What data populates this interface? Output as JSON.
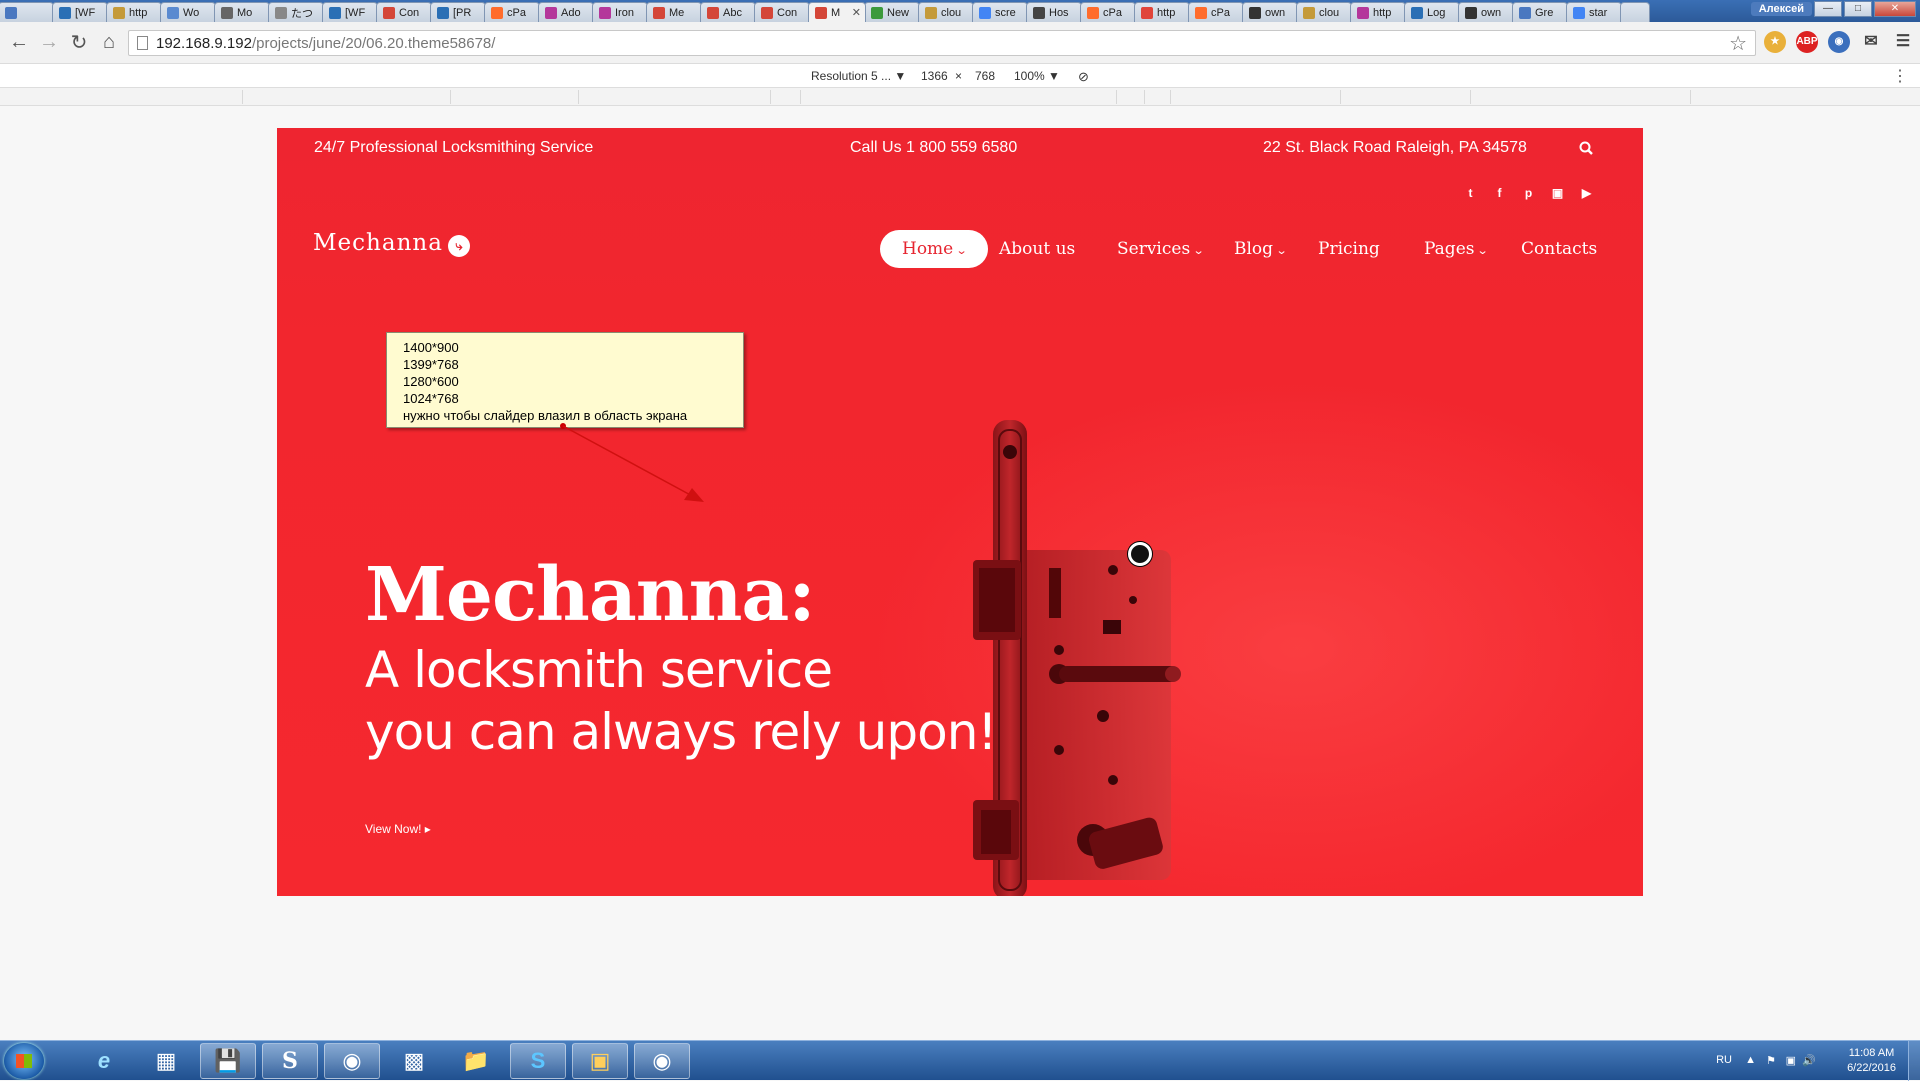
{
  "browser": {
    "tabs": [
      {
        "label": "",
        "color": "#4a78c0"
      },
      {
        "label": "[WF",
        "color": "#2a6fb5"
      },
      {
        "label": "http",
        "color": "#c49a3a"
      },
      {
        "label": "Wo",
        "color": "#5a8ad0"
      },
      {
        "label": "Mo",
        "color": "#666666"
      },
      {
        "label": "たつ",
        "color": "#888888"
      },
      {
        "label": "[WF",
        "color": "#2a6fb5"
      },
      {
        "label": "Con",
        "color": "#d44638"
      },
      {
        "label": "[PR",
        "color": "#2a6fb5"
      },
      {
        "label": "cPa",
        "color": "#ff6c2c"
      },
      {
        "label": "Ado",
        "color": "#b4379b"
      },
      {
        "label": "Iron",
        "color": "#b4379b"
      },
      {
        "label": "Me",
        "color": "#d44638"
      },
      {
        "label": "Abc",
        "color": "#d44638"
      },
      {
        "label": "Con",
        "color": "#d44638"
      },
      {
        "label": "M",
        "color": "#d44638",
        "active": true
      },
      {
        "label": "New",
        "color": "#3c9a3c"
      },
      {
        "label": "clou",
        "color": "#c49a3a"
      },
      {
        "label": "scre",
        "color": "#4285f4"
      },
      {
        "label": "Hos",
        "color": "#444444"
      },
      {
        "label": "cPa",
        "color": "#ff6c2c"
      },
      {
        "label": "http",
        "color": "#e0443a"
      },
      {
        "label": "cPa",
        "color": "#ff6c2c"
      },
      {
        "label": "own",
        "color": "#333333"
      },
      {
        "label": "clou",
        "color": "#c49a3a"
      },
      {
        "label": "http",
        "color": "#b4379b"
      },
      {
        "label": "Log",
        "color": "#2a6fb5"
      },
      {
        "label": "own",
        "color": "#333333"
      },
      {
        "label": "Gre",
        "color": "#4a78c0"
      },
      {
        "label": "star",
        "color": "#4285f4"
      }
    ],
    "user_label": "Алексей",
    "url_host": "192.168.9.192",
    "url_path": "/projects/june/20/06.20.theme58678/"
  },
  "device_toolbar": {
    "preset": "Resolution 5 ... ▼",
    "width": "1366",
    "times": "×",
    "height": "768",
    "zoom": "100% ▼"
  },
  "site": {
    "topbar": {
      "tagline": "24/7 Professional Locksmithing Service",
      "phone": "Call Us 1 800 559 6580",
      "address": "22 St. Black Road Raleigh, PA 34578"
    },
    "social_icons": [
      "twitter-icon",
      "facebook-icon",
      "pinterest-icon",
      "instagram-icon",
      "youtube-icon"
    ],
    "logo": "Mechanna",
    "nav": [
      {
        "label": "Home",
        "dropdown": true,
        "active": true
      },
      {
        "label": "About us",
        "dropdown": false
      },
      {
        "label": "Services",
        "dropdown": true
      },
      {
        "label": "Blog",
        "dropdown": true
      },
      {
        "label": "Pricing",
        "dropdown": false
      },
      {
        "label": "Pages",
        "dropdown": true
      },
      {
        "label": "Contacts",
        "dropdown": false
      }
    ],
    "hero": {
      "title": "Mechanna:",
      "subtitle_line1": "A locksmith service",
      "subtitle_line2": "you can always rely upon!",
      "cta": "View Now! ▸"
    },
    "accent_color": "#f0252f"
  },
  "annotation": {
    "lines": [
      "1400*900",
      "1399*768",
      "1280*600",
      "1024*768",
      "нужно чтобы слайдер влазил в область экрана"
    ]
  },
  "taskbar": {
    "lang": "RU",
    "time": "11:08 AM",
    "date": "6/22/2016"
  }
}
